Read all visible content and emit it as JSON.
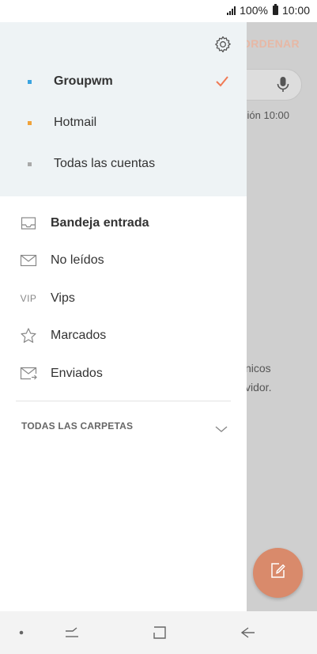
{
  "status_bar": {
    "battery": "100%",
    "time": "10:00"
  },
  "background_app": {
    "sort_label": "ORDENAR",
    "search_meta": "ción  10:00",
    "text_line1": "nicos",
    "text_line2": "vidor."
  },
  "drawer": {
    "accounts": [
      {
        "label": "Groupwm",
        "selected": true,
        "color": "#3aa4e0"
      },
      {
        "label": "Hotmail",
        "selected": false,
        "color": "#f0a23a"
      },
      {
        "label": "Todas las cuentas",
        "selected": false,
        "color": "#a9a9a9"
      }
    ],
    "folders": [
      {
        "label": "Bandeja entrada",
        "icon": "inbox-icon",
        "active": true
      },
      {
        "label": "No leídos",
        "icon": "mail-icon"
      },
      {
        "label": "Vips",
        "icon": "vip-icon",
        "icon_text": "VIP"
      },
      {
        "label": "Marcados",
        "icon": "star-icon"
      },
      {
        "label": "Enviados",
        "icon": "sent-icon"
      }
    ],
    "all_folders_label": "TODAS LAS CARPETAS"
  },
  "colors": {
    "accent": "#f07a55",
    "fab": "#d98a6b",
    "drawer_header_bg": "#eef3f5"
  },
  "nav_bar": {
    "items": [
      "dot-icon",
      "recent-apps-icon",
      "home-icon",
      "back-icon"
    ]
  }
}
